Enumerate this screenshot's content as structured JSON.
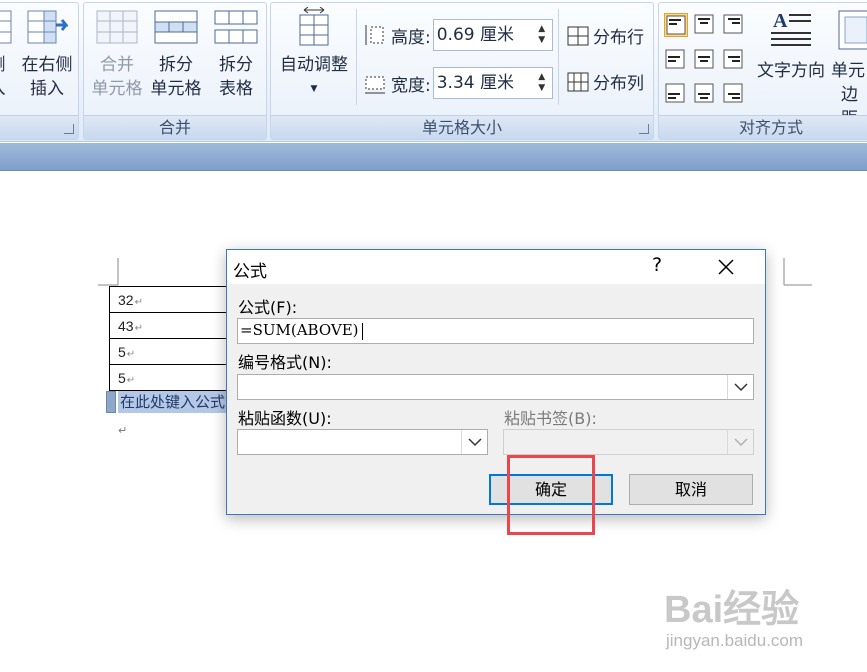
{
  "ribbon": {
    "groups": {
      "left_partial": {
        "btn1": "侧",
        "btn1_line2": "入",
        "btn2": "在右侧",
        "btn2_line2": "插入"
      },
      "merge": {
        "label": "合并",
        "merge_cells": "合并",
        "merge_cells_line2": "单元格",
        "split_cells": "拆分",
        "split_cells_line2": "单元格",
        "split_table": "拆分",
        "split_table_line2": "表格"
      },
      "cell_size": {
        "label": "单元格大小",
        "autofit": "自动调整",
        "height_label": "高度:",
        "height_value": "0.69 厘米",
        "width_label": "宽度:",
        "width_value": "3.34 厘米",
        "distribute_rows": "分布行",
        "distribute_cols": "分布列"
      },
      "alignment": {
        "label": "对齐方式",
        "text_direction": "文字方向",
        "cell_margins": "单元",
        "cell_margins_line2": "边距"
      }
    }
  },
  "document": {
    "table_values": [
      "32",
      "43",
      "5",
      "5"
    ],
    "cell_mark": "↵",
    "field_placeholder": "在此处键入公式",
    "paragraph_mark": "↵"
  },
  "dialog": {
    "title": "公式",
    "help": "?",
    "formula_label": "公式(F):",
    "formula_value": "=SUM(ABOVE)",
    "number_format_label": "编号格式(N):",
    "number_format_value": "",
    "paste_function_label": "粘贴函数(U):",
    "paste_function_value": "",
    "paste_bookmark_label": "粘贴书签(B):",
    "paste_bookmark_value": "",
    "ok_label": "确定",
    "cancel_label": "取消"
  },
  "watermark": {
    "main": "Bai经验",
    "sub": "jingyan.baidu.com"
  },
  "colors": {
    "accent": "#0078d7",
    "highlight": "#e8484d",
    "ribbon": "#dfe9f6"
  }
}
